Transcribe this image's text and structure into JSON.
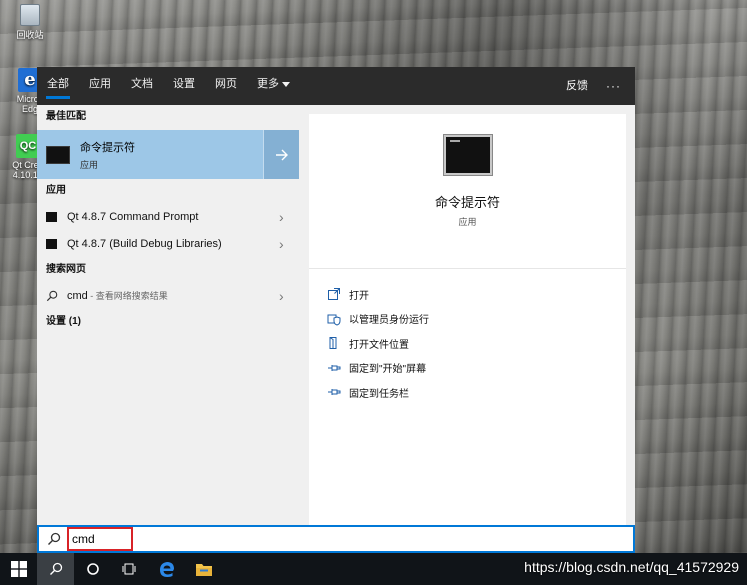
{
  "desktop": {
    "icons": [
      {
        "label": "回收站"
      },
      {
        "label": "Micros Edg"
      },
      {
        "label": "Qt Crea 4.10.1 ("
      }
    ]
  },
  "panel": {
    "tabs": [
      "全部",
      "应用",
      "文档",
      "设置",
      "网页",
      "更多"
    ],
    "feedback": "反馈",
    "more_options": "···",
    "sections": {
      "best_match": "最佳匹配",
      "apps": "应用",
      "web": "搜索网页",
      "settings": "设置 (1)"
    },
    "best_match": {
      "title": "命令提示符",
      "subtitle": "应用"
    },
    "apps": [
      {
        "label": "Qt 4.8.7 Command Prompt"
      },
      {
        "label": "Qt 4.8.7 (Build Debug Libraries)"
      }
    ],
    "web_result": {
      "query": "cmd",
      "suffix": " - 查看网络搜索结果"
    },
    "preview": {
      "title": "命令提示符",
      "subtitle": "应用"
    },
    "actions": [
      {
        "label": "打开",
        "icon": "open-icon"
      },
      {
        "label": "以管理员身份运行",
        "icon": "shield-icon"
      },
      {
        "label": "打开文件位置",
        "icon": "folder-icon"
      },
      {
        "label": "固定到\"开始\"屏幕",
        "icon": "pin-icon"
      },
      {
        "label": "固定到任务栏",
        "icon": "pin-icon"
      }
    ]
  },
  "search": {
    "value": "cmd"
  },
  "watermark": "https://blog.csdn.net/qq_41572929",
  "colors": {
    "accent": "#0078d7",
    "selected": "#9dc7e7",
    "highlight_border": "#d82227"
  }
}
